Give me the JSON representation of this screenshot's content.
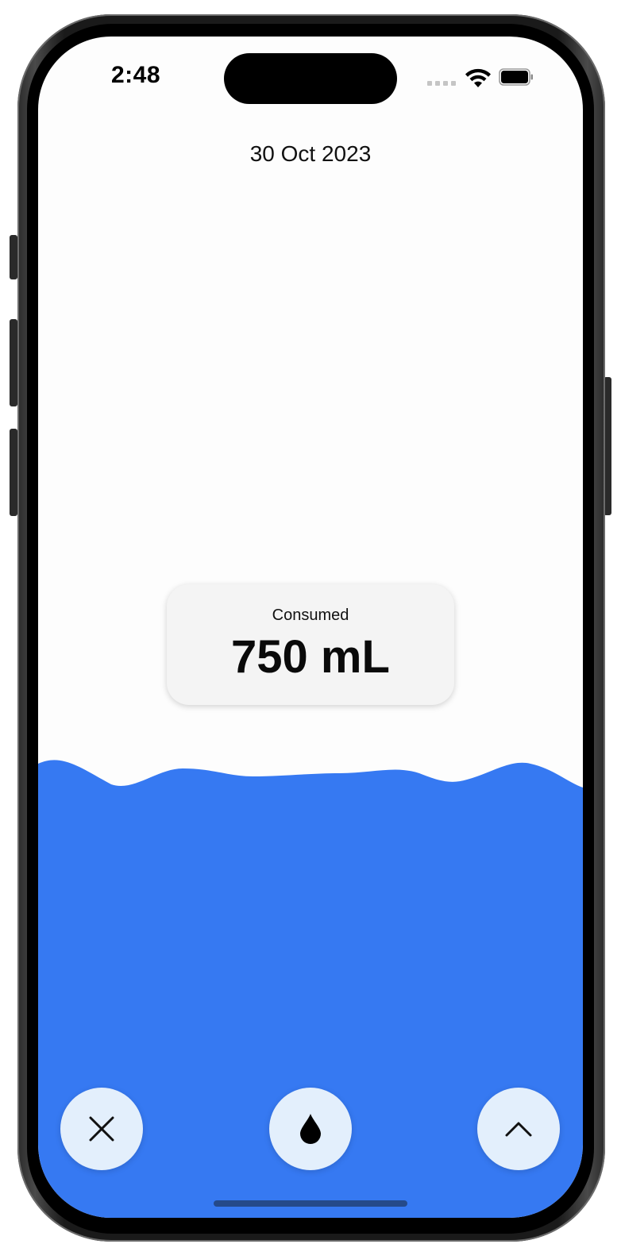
{
  "status_bar": {
    "time": "2:48"
  },
  "header": {
    "date": "30 Oct 2023"
  },
  "summary_card": {
    "label": "Consumed",
    "value": "750 mL"
  },
  "controls": {
    "left_icon": "close-icon",
    "center_icon": "water-drop-icon",
    "right_icon": "chevron-up-icon"
  },
  "colors": {
    "water": "#3679f2",
    "button_bg": "#e3effc",
    "card_bg": "#f4f4f4",
    "screen_bg": "#fdfdfd"
  }
}
